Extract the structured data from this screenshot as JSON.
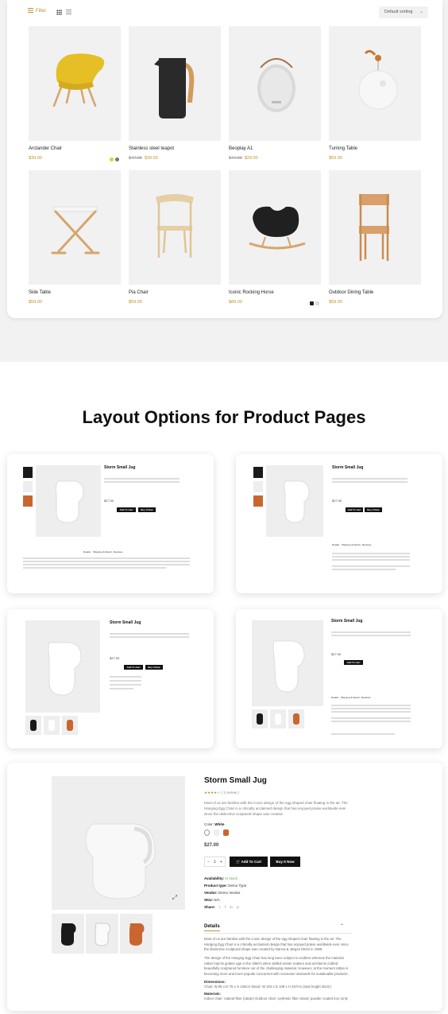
{
  "toolbar": {
    "filter_label": "Filter",
    "sort_label": "Default sorting"
  },
  "products": [
    {
      "name": "Arctander Chair",
      "price": "$39.00",
      "old_price": ""
    },
    {
      "name": "Stainless steel teapot",
      "price": "$39.00",
      "old_price": "$47.00"
    },
    {
      "name": "Beoplay A1",
      "price": "$29.00",
      "old_price": "$47.00"
    },
    {
      "name": "Turning Table",
      "price": "$59.00",
      "old_price": ""
    },
    {
      "name": "Side Table",
      "price": "$59.00",
      "old_price": ""
    },
    {
      "name": "Pia Chair",
      "price": "$59.00",
      "old_price": ""
    },
    {
      "name": "Iconic Rocking Horse",
      "price": "$89.00",
      "old_price": ""
    },
    {
      "name": "Outdoor Dining Table",
      "price": "$59.00",
      "old_price": ""
    }
  ],
  "colors": {
    "accent": "#c0902e",
    "yellow_swatch": "#e7d21c",
    "gray_swatch": "#777777",
    "dark": "#111111"
  },
  "layout_section": {
    "heading": "Layout Options for Product Pages"
  },
  "product_page": {
    "title": "Storm Small Jug",
    "reviews": "( 1 review )",
    "description": "Most of us are familiar with the iconic design of the egg shaped chair floating in the air. The Hanging Egg Chair is a critically acclaimed design that has enjoyed praise worldwide ever since the distinctive sculptural shape was created.",
    "color_label": "Color:",
    "color_value": "White",
    "price": "$27.00",
    "qty": "1",
    "minus": "−",
    "plus": "+",
    "add_to_cart": "Add To Cart",
    "buy_now": "Buy It Now",
    "availability_label": "Availability:",
    "availability_value": "In stock",
    "type_label": "Product type:",
    "type_value": "Demo Type",
    "vendor_label": "Vendor:",
    "vendor_value": "Demo Vendor",
    "sku_label": "SKU:",
    "sku_value": "N/A",
    "share_label": "Share:",
    "share_icons": [
      "twitter-icon",
      "facebook-icon",
      "linkedin-icon",
      "pinterest-icon"
    ],
    "details_tab": "Details",
    "tabs": [
      "Details",
      "Shipping & Return",
      "Reviews"
    ],
    "details_text": "Most of us are familiar with the iconic design of the egg shaped chair floating in the air. The Hanging Egg Chair is a critically acclaimed design that has enjoyed praise worldwide ever since the distinctive sculptural shape was created by Nanna & Jørgen Ditzel in 1959.",
    "details_text_2": "The design of the Hanging Egg Chair has long been subject to endless whereas the material rattan had its golden age in the 1960's when skilled wicker makers and architects crafted beautifully sculptured furniture out of the challenging material. However, at the moment rattan is becoming more and more popular concurrent with consumer demands for sustainable products.",
    "dimensions_label": "Dimensions:",
    "dimensions_text": "Chair: W 85 x D 75 x H 125cm Stand: W 104 x D 109 x H 207cm (seat height 45cm)",
    "materials_label": "Materials:",
    "materials_text": "Indoor chair: natural fiber (rattan) Outdoor chair: synthetic fiber Stand: powder coated iron (only"
  }
}
